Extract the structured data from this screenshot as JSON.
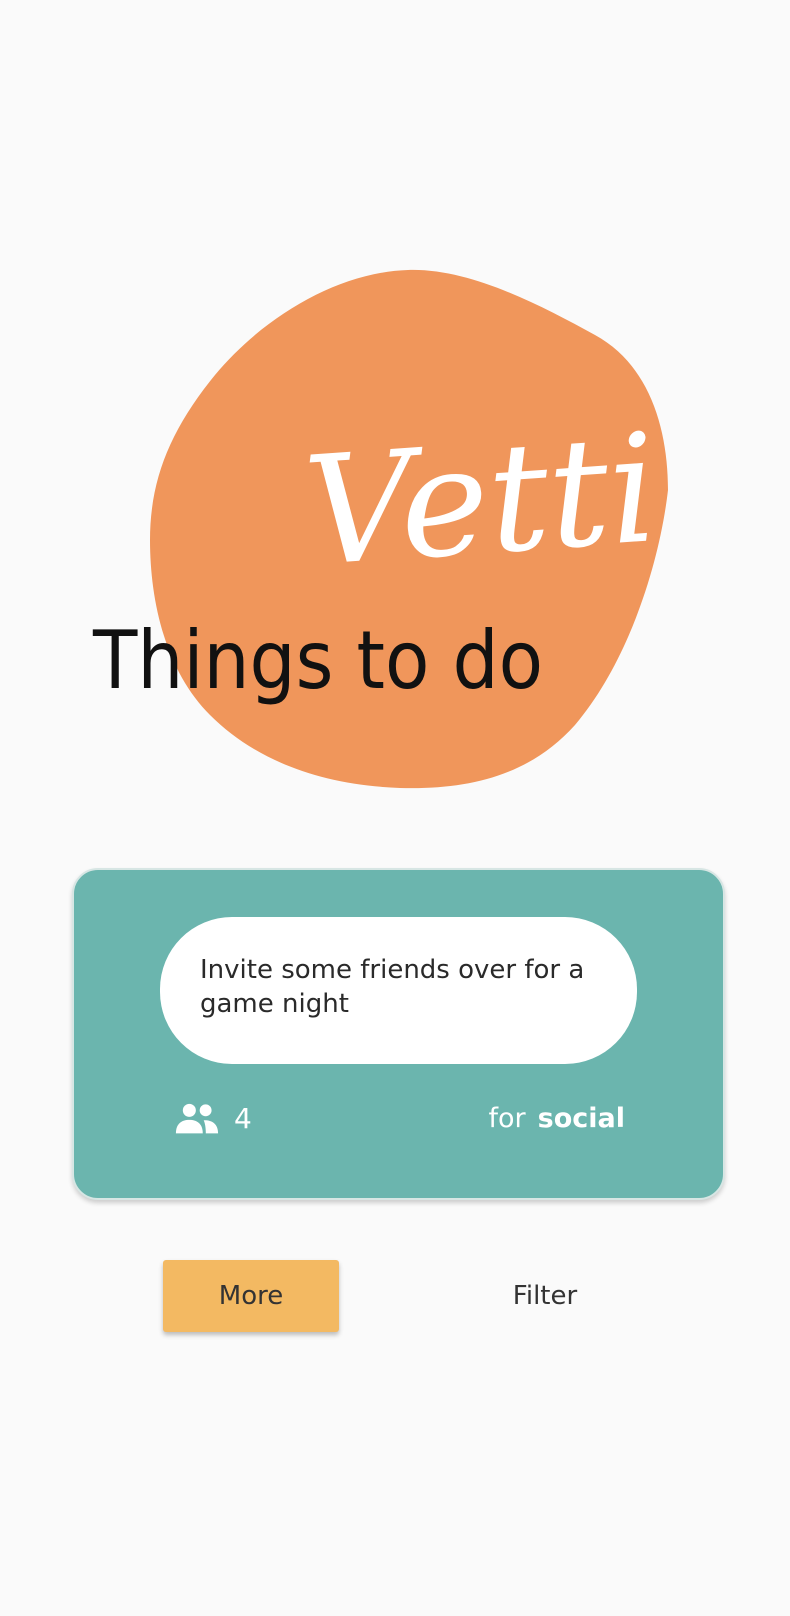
{
  "logo": {
    "script_text": "Vetti",
    "tagline": "Things to do",
    "blob_color": "#f0965b"
  },
  "activity": {
    "text": "Invite some friends over for a game night",
    "participants_icon": "people-icon",
    "participants": "4",
    "for_label": "for",
    "type": "social",
    "card_color": "#6bb5ae"
  },
  "buttons": {
    "more_label": "More",
    "filter_label": "Filter",
    "more_color": "#f3b962"
  }
}
